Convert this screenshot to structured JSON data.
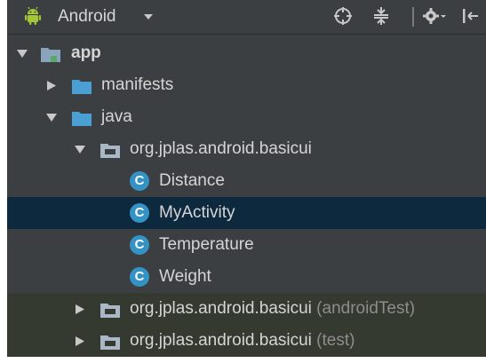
{
  "toolbar": {
    "view_title": "Android",
    "colors": {
      "android_green": "#a4c639",
      "panel_bg": "#3c3f41",
      "text": "#d5d5d5"
    },
    "icons": [
      "android-icon",
      "dropdown-arrow-icon",
      "locate-target-icon",
      "collapse-all-icon",
      "gear-icon",
      "hide-panel-icon"
    ]
  },
  "tree": {
    "app": {
      "label": "app",
      "icon": "module-folder-icon",
      "expanded": true
    },
    "manifests": {
      "label": "manifests",
      "icon": "folder-icon",
      "expanded": false
    },
    "java": {
      "label": "java",
      "icon": "folder-icon",
      "expanded": true
    },
    "main_package": {
      "label": "org.jplas.android.basicui",
      "icon": "package-icon",
      "expanded": true
    },
    "classes": [
      {
        "label": "Distance",
        "icon": "class-icon",
        "badge": "C"
      },
      {
        "label": "MyActivity",
        "icon": "class-icon",
        "badge": "C",
        "selected": true
      },
      {
        "label": "Temperature",
        "icon": "class-icon",
        "badge": "C"
      },
      {
        "label": "Weight",
        "icon": "class-icon",
        "badge": "C"
      }
    ],
    "android_test_package": {
      "label": "org.jplas.android.basicui",
      "suffix": " (androidTest)",
      "icon": "package-icon",
      "expanded": false
    },
    "test_package": {
      "label": "org.jplas.android.basicui",
      "suffix": " (test)",
      "icon": "package-icon",
      "expanded": false
    }
  },
  "selection_color": "#0d293e",
  "test_row_color": "#353a30",
  "class_badge_color": "#3592c4"
}
